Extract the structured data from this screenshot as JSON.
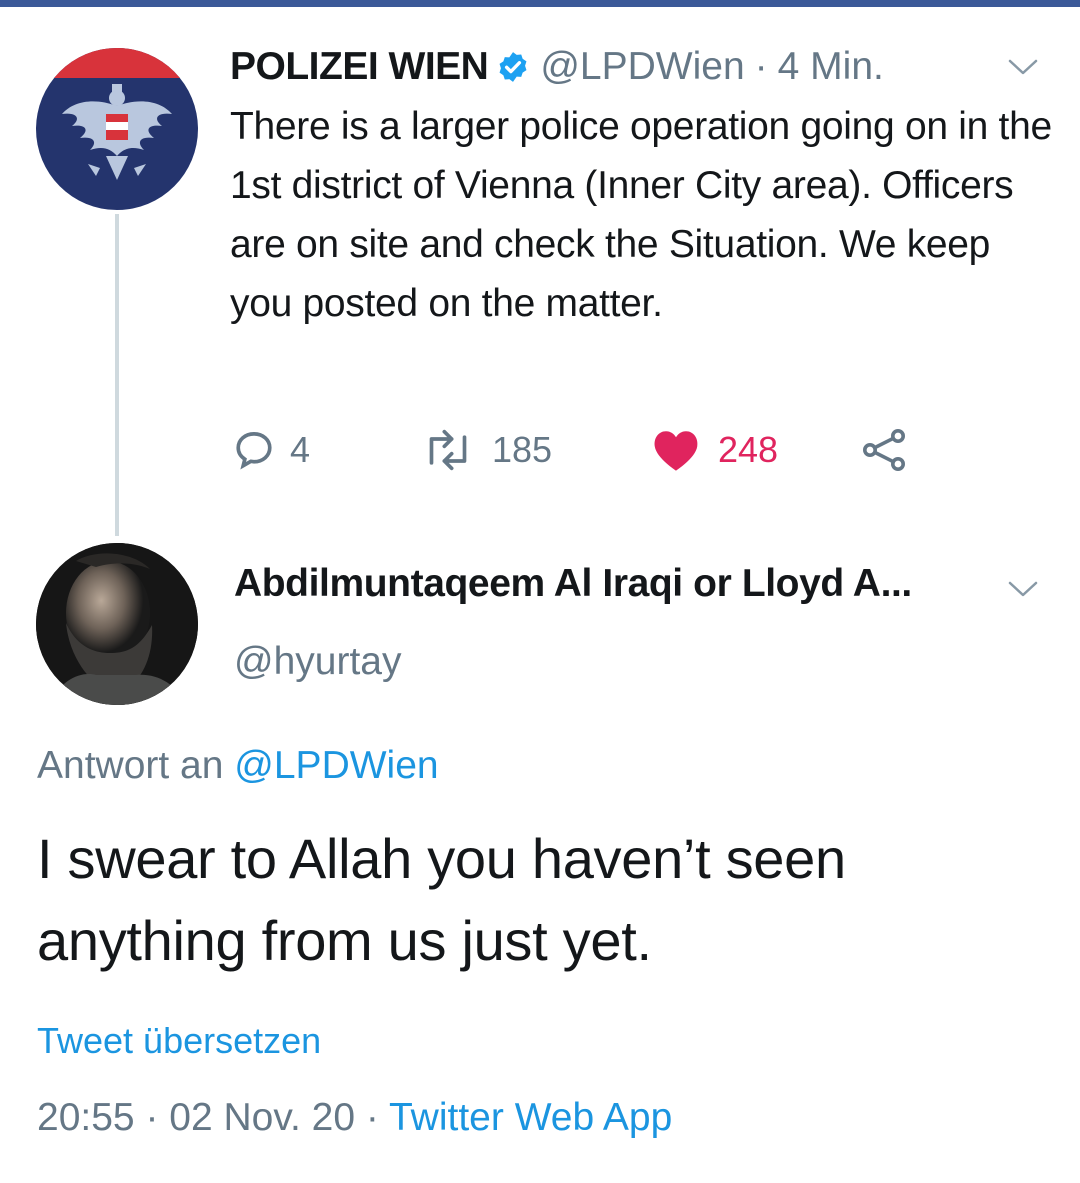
{
  "colors": {
    "text": "#14171a",
    "secondary": "#657786",
    "link": "#1b95e0",
    "like": "#e0245e",
    "top_bar": "#3b5998"
  },
  "tweet": {
    "author_name": "POLIZEI WIEN",
    "verified_icon": "verified-badge-icon",
    "handle": "@LPDWien",
    "separator": "·",
    "time": "4 Min.",
    "text": "There is a larger police operation going on in the 1st district of Vienna (Inner City area). Officers are on site and check the Situation. We keep you posted on the matter.",
    "actions": {
      "reply_count": "4",
      "retweet_count": "185",
      "like_count": "248",
      "reply_icon": "reply-bubble-icon",
      "retweet_icon": "retweet-icon",
      "like_icon": "heart-icon",
      "share_icon": "share-icon"
    }
  },
  "reply": {
    "author_name": "Abdilmuntaqeem Al Iraqi or Lloyd A...",
    "handle": "@hyurtay",
    "reply_prefix": "Antwort an",
    "reply_mention": "@LPDWien",
    "text": "I swear to Allah you haven’t seen anything from us just yet.",
    "translate_label": "Tweet übersetzen",
    "time": "20:55",
    "separator": "·",
    "date": "02 Nov. 20",
    "source": "Twitter Web App"
  }
}
